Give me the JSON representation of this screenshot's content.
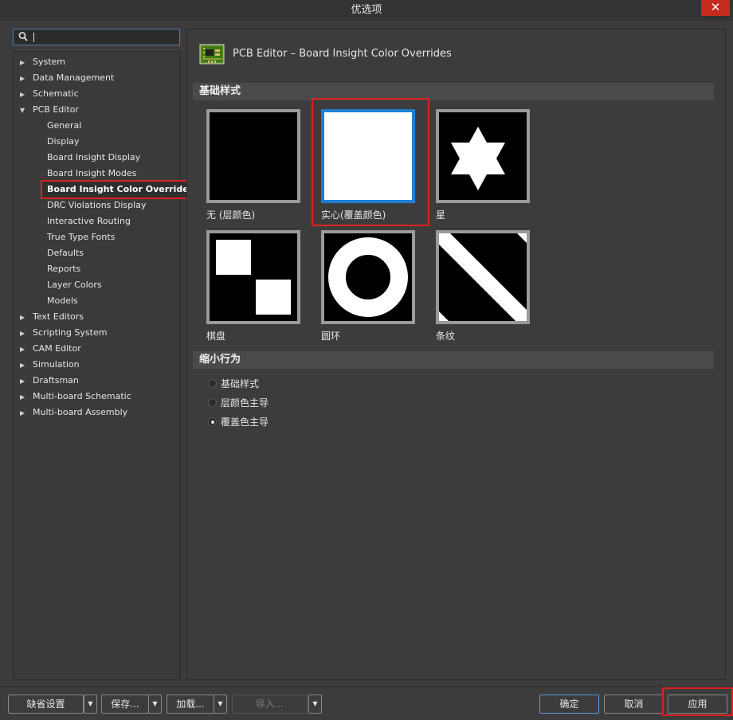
{
  "window": {
    "title": "优选项",
    "close_symbol": "✕"
  },
  "search": {
    "value": ""
  },
  "tree": {
    "items": [
      {
        "label": "System",
        "level": 0,
        "expanded": false
      },
      {
        "label": "Data Management",
        "level": 0,
        "expanded": false
      },
      {
        "label": "Schematic",
        "level": 0,
        "expanded": false
      },
      {
        "label": "PCB Editor",
        "level": 0,
        "expanded": true
      },
      {
        "label": "General",
        "level": 1
      },
      {
        "label": "Display",
        "level": 1
      },
      {
        "label": "Board Insight Display",
        "level": 1
      },
      {
        "label": "Board Insight Modes",
        "level": 1
      },
      {
        "label": "Board Insight Color Overrides *",
        "level": 1,
        "selected": true
      },
      {
        "label": "DRC Violations Display",
        "level": 1
      },
      {
        "label": "Interactive Routing",
        "level": 1
      },
      {
        "label": "True Type Fonts",
        "level": 1
      },
      {
        "label": "Defaults",
        "level": 1
      },
      {
        "label": "Reports",
        "level": 1
      },
      {
        "label": "Layer Colors",
        "level": 1
      },
      {
        "label": "Models",
        "level": 1
      },
      {
        "label": "Text Editors",
        "level": 0,
        "expanded": false
      },
      {
        "label": "Scripting System",
        "level": 0,
        "expanded": false
      },
      {
        "label": "CAM Editor",
        "level": 0,
        "expanded": false
      },
      {
        "label": "Simulation",
        "level": 0,
        "expanded": false
      },
      {
        "label": "Draftsman",
        "level": 0,
        "expanded": false
      },
      {
        "label": "Multi-board Schematic",
        "level": 0,
        "expanded": false
      },
      {
        "label": "Multi-board Assembly",
        "level": 0,
        "expanded": false
      }
    ]
  },
  "main": {
    "title": "PCB Editor – Board Insight Color Overrides",
    "section_base": "基础样式",
    "patterns": [
      {
        "label": "无 (层颜色)",
        "selected": false
      },
      {
        "label": "实心(覆盖颜色)",
        "selected": true
      },
      {
        "label": "星",
        "selected": false
      },
      {
        "label": "棋盘",
        "selected": false
      },
      {
        "label": "圆环",
        "selected": false
      },
      {
        "label": "条纹",
        "selected": false
      }
    ],
    "section_zoom": "缩小行为",
    "zoom_options": [
      {
        "label": "基础样式",
        "checked": false
      },
      {
        "label": "层颜色主导",
        "checked": false
      },
      {
        "label": "覆盖色主导",
        "checked": true
      }
    ]
  },
  "footer": {
    "defaults": "缺省设置",
    "save": "保存...",
    "load": "加载...",
    "import": "导入...",
    "ok": "确定",
    "cancel": "取消",
    "apply": "应用"
  },
  "colors": {
    "accent": "#1e7fd4",
    "highlight": "#e02020",
    "close": "#c42b1c"
  }
}
